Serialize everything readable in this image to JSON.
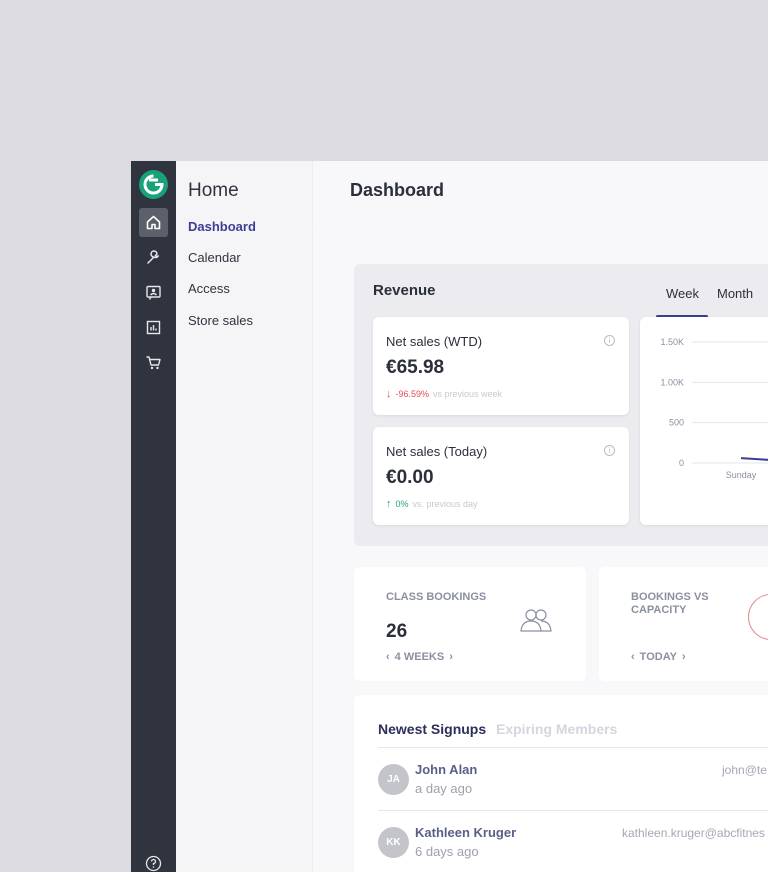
{
  "colors": {
    "accent": "#3c3f94",
    "brand": "#17a27a",
    "rail_bg": "#2f343f",
    "negative": "#e24c5c",
    "positive": "#1fa86b"
  },
  "rail": {
    "icons": [
      "home-icon",
      "wrench-icon",
      "contact-card-icon",
      "bar-chart-icon",
      "cart-icon",
      "help-icon"
    ]
  },
  "subnav": {
    "title": "Home",
    "items": [
      {
        "label": "Dashboard",
        "active": true
      },
      {
        "label": "Calendar",
        "active": false
      },
      {
        "label": "Access",
        "active": false
      },
      {
        "label": "Store sales",
        "active": false
      }
    ]
  },
  "page": {
    "title": "Dashboard"
  },
  "revenue": {
    "title": "Revenue",
    "tabs": [
      {
        "label": "Week",
        "active": true
      },
      {
        "label": "Month",
        "active": false
      }
    ],
    "net_sales_wtd": {
      "label": "Net sales (WTD)",
      "value": "€65.98",
      "delta": "-96.59%",
      "delta_note": "vs previous week"
    },
    "net_sales_today": {
      "label": "Net sales (Today)",
      "value": "€0.00",
      "delta": "0%",
      "delta_note": "vs. previous day"
    }
  },
  "chart_data": {
    "type": "line",
    "categories": [
      "Sunday"
    ],
    "yticks": [
      "1.50K",
      "1.00K",
      "500",
      "0"
    ],
    "ylim": [
      0,
      1500
    ],
    "series": [
      {
        "values": [
          60
        ]
      }
    ],
    "grid": true
  },
  "stats": {
    "class_bookings": {
      "label": "CLASS BOOKINGS",
      "value": "26",
      "period": "4 WEEKS"
    },
    "bookings_vs_capacity": {
      "label": "BOOKINGS VS CAPACITY",
      "period": "TODAY"
    }
  },
  "signups": {
    "tabs": [
      {
        "label": "Newest Signups",
        "active": true
      },
      {
        "label": "Expiring Members",
        "active": false
      }
    ],
    "rows": [
      {
        "initials": "JA",
        "name": "John Alan",
        "time": "a day ago",
        "email": "john@te"
      },
      {
        "initials": "KK",
        "name": "Kathleen Kruger",
        "time": "6 days ago",
        "email": "kathleen.kruger@abcfitnes"
      }
    ]
  }
}
